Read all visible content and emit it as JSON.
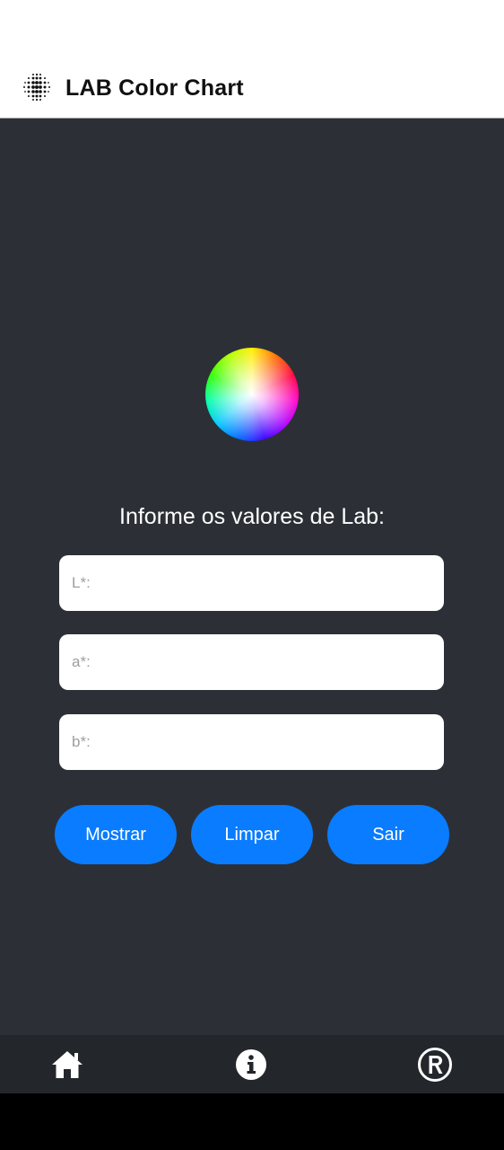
{
  "header": {
    "title": "LAB Color Chart",
    "logo_icon": "dotted-sphere-icon"
  },
  "main": {
    "image_icon": "color-wheel-icon",
    "prompt": "Informe os valores de Lab:",
    "fields": {
      "l": {
        "placeholder": "L*:",
        "value": ""
      },
      "a": {
        "placeholder": "a*:",
        "value": ""
      },
      "b": {
        "placeholder": "b*:",
        "value": ""
      }
    },
    "buttons": {
      "show": "Mostrar",
      "clear": "Limpar",
      "exit": "Sair"
    }
  },
  "bottom_nav": {
    "items": [
      {
        "icon": "home-icon"
      },
      {
        "icon": "info-icon"
      },
      {
        "icon": "registered-icon"
      }
    ]
  },
  "colors": {
    "background": "#2c3036",
    "header": "#ffffff",
    "accent": "#0a7cff",
    "nav": "#23272b",
    "system_bar": "#000000"
  }
}
